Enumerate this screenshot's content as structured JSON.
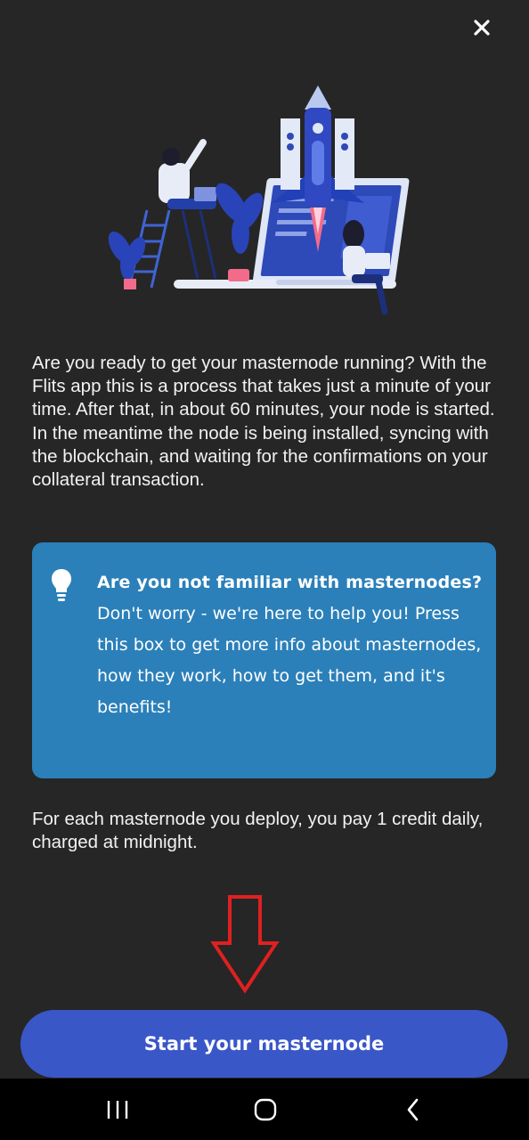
{
  "header": {
    "close_icon": "close-icon"
  },
  "intro": {
    "text": "Are you ready to get your masternode running? With the Flits app this is a process that takes just a minute of your time. After that, in about 60 minutes, your node is started. In the meantime the node is being installed, syncing with the blockchain, and waiting for the confirmations on your collateral transaction."
  },
  "info_box": {
    "icon": "lightbulb-icon",
    "title": "Are you not familiar with masternodes?",
    "body": "Don't worry - we're here to help you! Press this box to get more info about masternodes, how they work, how to get them, and it's benefits!",
    "background": "#2b80b9"
  },
  "credit_note": {
    "text": "For each masternode you deploy, you pay 1 credit daily, charged at midnight."
  },
  "annotation": {
    "icon": "down-arrow-icon",
    "color": "#e02020"
  },
  "start_button": {
    "label": "Start your masternode",
    "color": "#3a57c8"
  },
  "navbar": {
    "recents_icon": "recents-icon",
    "home_icon": "home-icon",
    "back_icon": "back-icon"
  }
}
